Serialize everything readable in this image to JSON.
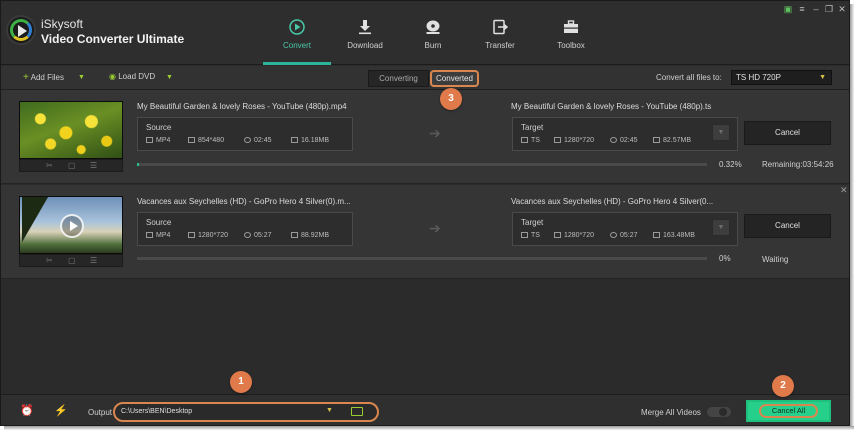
{
  "app": {
    "brand_line1": "iSkysoft",
    "brand_line2": "Video Converter Ultimate"
  },
  "nav": {
    "tabs": [
      {
        "label": "Convert",
        "icon": "convert-play-icon",
        "active": true
      },
      {
        "label": "Download",
        "icon": "download-icon"
      },
      {
        "label": "Burn",
        "icon": "burn-disc-icon"
      },
      {
        "label": "Transfer",
        "icon": "transfer-icon"
      },
      {
        "label": "Toolbox",
        "icon": "toolbox-icon"
      }
    ]
  },
  "toolbar": {
    "add_files": "Add Files",
    "load_dvd": "Load DVD",
    "converting_tab": "Converting",
    "converted_tab": "Converted",
    "convert_all_label": "Convert all files to:",
    "format_value": "TS HD 720P"
  },
  "tasks": [
    {
      "source_name": "My Beautiful Garden & lovely Roses - YouTube (480p).mp4",
      "target_name": "My Beautiful Garden & lovely Roses - YouTube (480p).ts",
      "source": {
        "label": "Source",
        "format": "MP4",
        "resolution": "854*480",
        "duration": "02:45",
        "size": "16.18MB"
      },
      "target": {
        "label": "Target",
        "format": "TS",
        "resolution": "1280*720",
        "duration": "02:45",
        "size": "82.57MB"
      },
      "cancel_label": "Cancel",
      "progress_text": "0.32%",
      "progress_value": 0.0032,
      "status": "Remaining:03:54:26"
    },
    {
      "source_name": "Vacances aux Seychelles (HD) - GoPro Hero 4 Silver(0).m...",
      "target_name": "Vacances aux Seychelles (HD) - GoPro Hero 4 Silver(0...",
      "source": {
        "label": "Source",
        "format": "MP4",
        "resolution": "1280*720",
        "duration": "05:27",
        "size": "88.92MB"
      },
      "target": {
        "label": "Target",
        "format": "TS",
        "resolution": "1280*720",
        "duration": "05:27",
        "size": "163.48MB"
      },
      "cancel_label": "Cancel",
      "progress_text": "0%",
      "progress_value": 0,
      "status": "Waiting"
    }
  ],
  "footer": {
    "output_label": "Output",
    "output_path": "C:\\Users\\BEN\\Desktop",
    "merge_label": "Merge All Videos",
    "cancel_all": "Cancel All"
  },
  "annotations": {
    "badge1": "1",
    "badge2": "2",
    "badge3": "3"
  },
  "colors": {
    "accent": "#2db59a",
    "callout": "#e07a4a",
    "progress": "#27c092",
    "cancel_all_bg": "#27d08a"
  }
}
